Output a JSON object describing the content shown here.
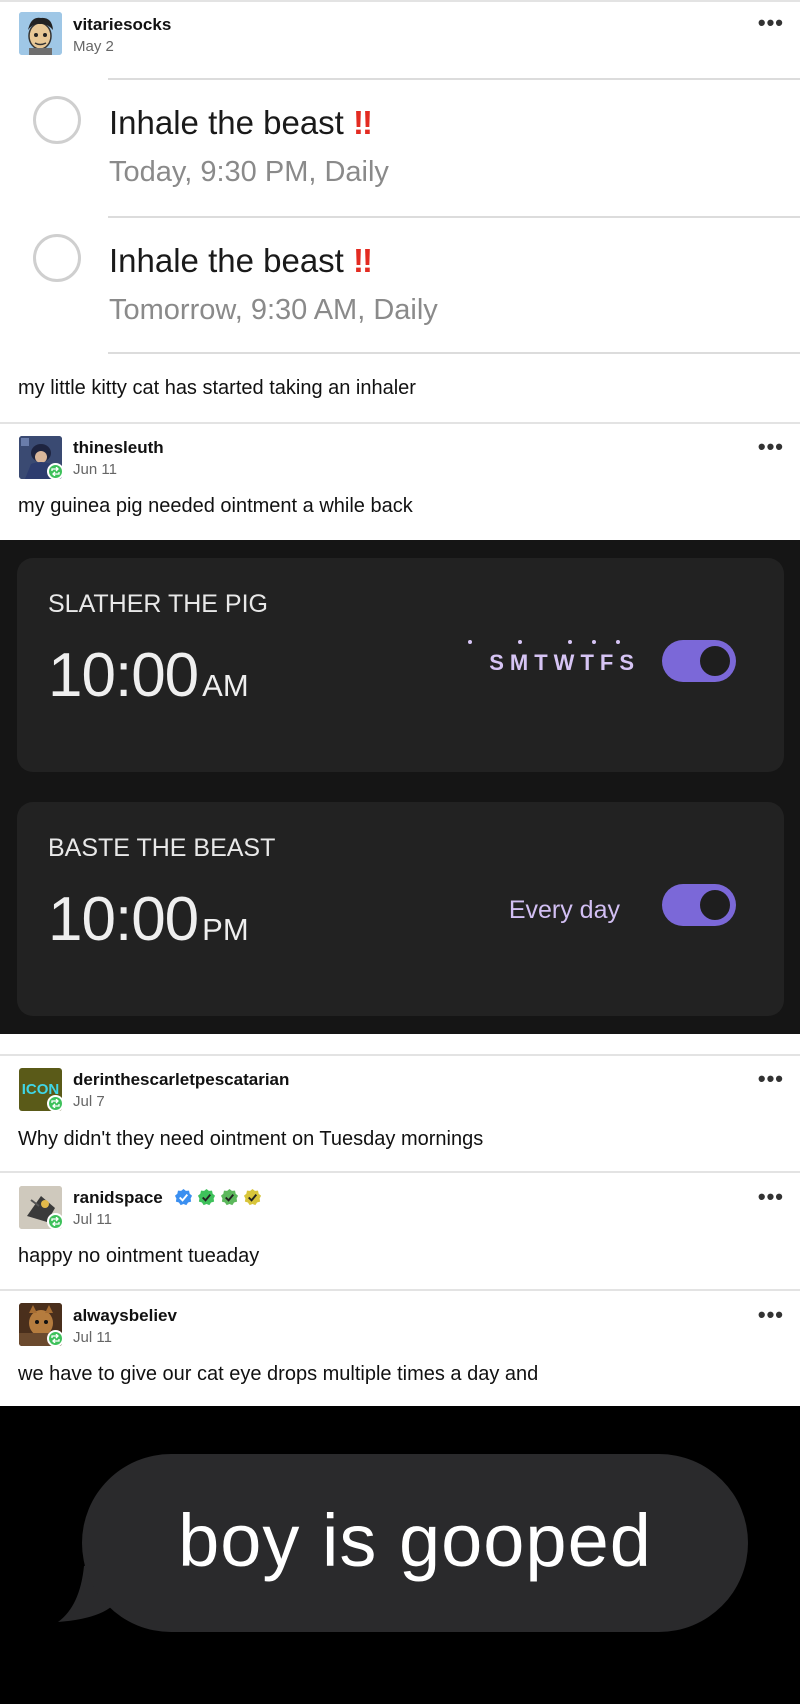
{
  "posts": [
    {
      "username": "vitariesocks",
      "date": "May 2",
      "text": "my little kitty cat has started taking an inhaler",
      "reminders": [
        {
          "title": "Inhale the beast",
          "flag": "!!",
          "when": "Today, 9:30 PM, Daily"
        },
        {
          "title": "Inhale the beast",
          "flag": "!!",
          "when": "Tomorrow, 9:30 AM, Daily"
        }
      ]
    },
    {
      "username": "thinesleuth",
      "date": "Jun 11",
      "text": "my guinea pig needed ointment a while back",
      "alarms": [
        {
          "label": "SLATHER THE PIG",
          "time": "10:00",
          "ampm": "AM",
          "repeat": "SMTWTFS",
          "enabled": true
        },
        {
          "label": "BASTE THE BEAST",
          "time": "10:00",
          "ampm": "PM",
          "repeat": "Every day",
          "enabled": true
        }
      ]
    },
    {
      "username": "derinthescarletpescatarian",
      "avatar_text": "ICON",
      "date": "Jul 7",
      "text": "Why didn't they need ointment on Tuesday mornings"
    },
    {
      "username": "ranidspace",
      "date": "Jul 11",
      "text": "happy no ointment tueaday",
      "badges": [
        "#3b8ff0",
        "#3ec15b",
        "#5cb85c",
        "#d8c53a"
      ]
    },
    {
      "username": "alwaysbeliev",
      "date": "Jul 11",
      "text": "we have to give our cat eye drops multiple times a day and",
      "bubble": "boy is gooped"
    }
  ],
  "more_icon": "ellipsis-icon",
  "reblog_icon": "reblog-icon",
  "accent": "#7b68d8",
  "reblog_color": "#3ec15b"
}
